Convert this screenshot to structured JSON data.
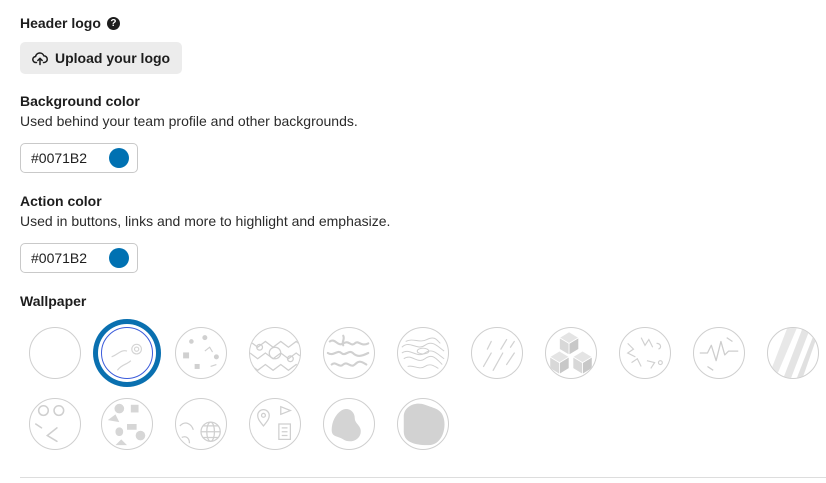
{
  "header_logo": {
    "label": "Header logo",
    "help_icon": "question-circle-icon",
    "upload_label": "Upload your logo",
    "upload_icon": "cloud-upload-icon"
  },
  "background_color": {
    "label": "Background color",
    "description": "Used behind your team profile and other backgrounds.",
    "value": "#0071B2",
    "swatch": "#0071B2"
  },
  "action_color": {
    "label": "Action color",
    "description": "Used in buttons, links and more to highlight and emphasize.",
    "value": "#0071B2",
    "swatch": "#0071B2"
  },
  "wallpaper": {
    "label": "Wallpaper",
    "selected_index": 1,
    "options": [
      "none",
      "swirl",
      "confetti",
      "tiles",
      "squiggle",
      "topography",
      "streaks",
      "cubes",
      "scribble",
      "waveform",
      "stripes",
      "doodles",
      "shapes",
      "globe",
      "places",
      "blobs",
      "blob"
    ]
  }
}
